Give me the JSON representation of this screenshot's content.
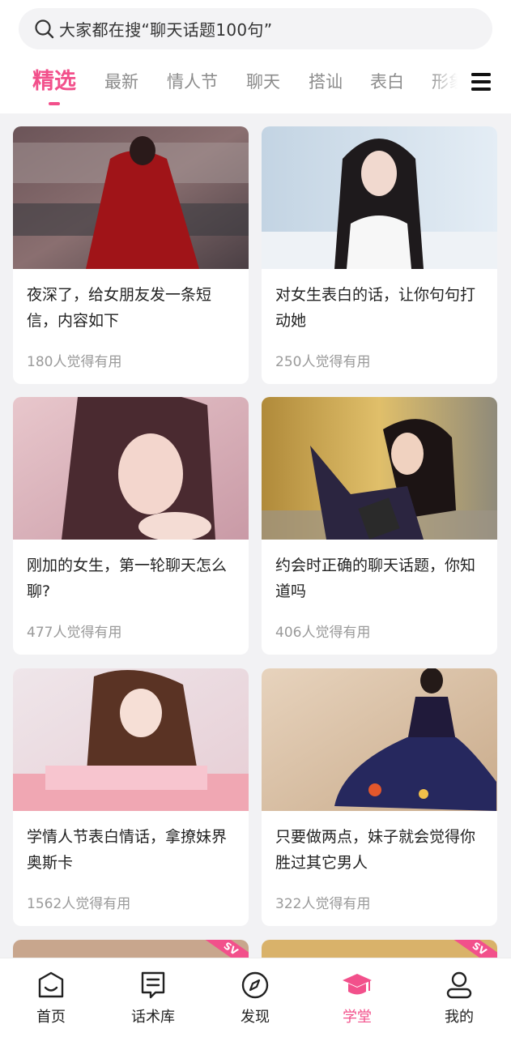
{
  "search": {
    "placeholder": "大家都在搜“聊天话题100句”"
  },
  "tabs": [
    {
      "label": "精选",
      "active": true
    },
    {
      "label": "最新"
    },
    {
      "label": "情人节"
    },
    {
      "label": "聊天"
    },
    {
      "label": "搭讪"
    },
    {
      "label": "表白"
    },
    {
      "label": "形象"
    }
  ],
  "cards": [
    {
      "title": "夜深了，给女朋友发一条短信，内容如下",
      "meta": "180人觉得有用"
    },
    {
      "title": "对女生表白的话，让你句句打动她",
      "meta": "250人觉得有用"
    },
    {
      "title": "刚加的女生，第一轮聊天怎么聊?",
      "meta": "477人觉得有用"
    },
    {
      "title": "约会时正确的聊天话题，你知道吗",
      "meta": "406人觉得有用"
    },
    {
      "title": "学情人节表白情话，拿撩妹界奥斯卡",
      "meta": "1562人觉得有用"
    },
    {
      "title": "只要做两点，妹子就会觉得你胜过其它男人",
      "meta": "322人觉得有用"
    }
  ],
  "partial_cards": [
    {
      "ribbon": "SV"
    },
    {
      "ribbon": "SV"
    }
  ],
  "bottom_nav": [
    {
      "label": "首页",
      "icon": "home-icon"
    },
    {
      "label": "话术库",
      "icon": "script-library-icon"
    },
    {
      "label": "发现",
      "icon": "compass-icon"
    },
    {
      "label": "学堂",
      "icon": "graduation-cap-icon",
      "active": true
    },
    {
      "label": "我的",
      "icon": "user-icon"
    }
  ],
  "colors": {
    "accent": "#f2508b",
    "background": "#f2f2f4"
  }
}
